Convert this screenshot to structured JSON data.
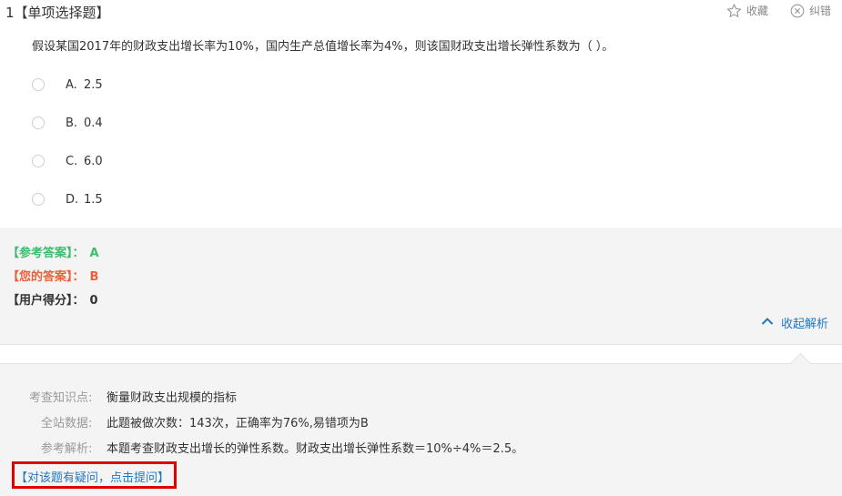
{
  "question": {
    "number": "1",
    "type": "【单项选择题】",
    "stem": "假设某国2017年的财政支出增长率为10%，国内生产总值增长率为4%，则该国财政支出增长弹性系数为（    ）。",
    "options": [
      {
        "letter": "A.",
        "text": "2.5"
      },
      {
        "letter": "B.",
        "text": "0.4"
      },
      {
        "letter": "C.",
        "text": "6.0"
      },
      {
        "letter": "D.",
        "text": "1.5"
      }
    ]
  },
  "header": {
    "favorite_label": "收藏",
    "report_label": "纠错",
    "favorite_icon": "star-outline-icon",
    "report_icon": "circle-x-icon"
  },
  "answer": {
    "reference_label": "【参考答案】：",
    "reference_value": "A",
    "yours_label": "【您的答案】：",
    "yours_value": "B",
    "score_label": "【用户得分】：",
    "score_value": "0",
    "collapse_label": "收起解析",
    "collapse_icon": "chevron-up-icon"
  },
  "analysis": {
    "knowledge_label": "考查知识点:",
    "knowledge_value": "衡量财政支出规模的指标",
    "stats_label": "全站数据:",
    "stats_value": "此题被做次数：143次，正确率为76%,易错项为B",
    "explain_label": "参考解析:",
    "explain_value": "本题考查财政支出增长的弹性系数。财政支出增长弹性系数＝10%÷4%＝2.5。",
    "ask_link": "【对该题有疑问，点击提问】"
  },
  "colors": {
    "correct": "#3ebd6f",
    "wrong": "#e8603c",
    "link": "#1f76c3",
    "highlight_box": "#e00000",
    "panel_bg": "#f4f4f4"
  }
}
